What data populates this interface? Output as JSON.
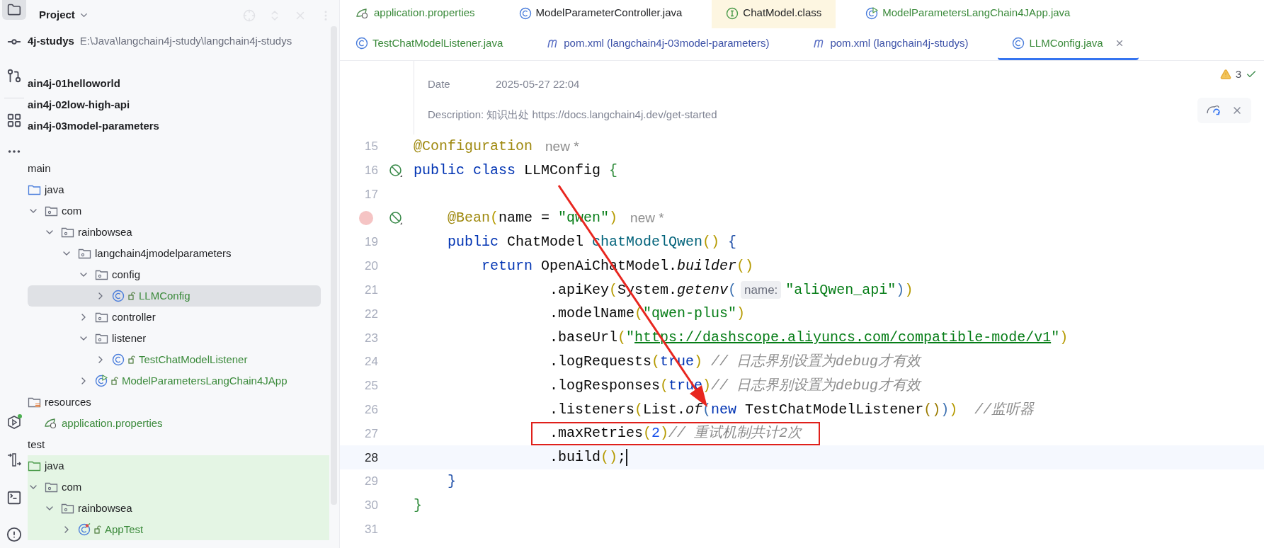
{
  "project_panel": {
    "title": "Project",
    "tree": [
      {
        "label": "4j-studys",
        "kind": "module_root",
        "path": "E:\\Java\\langchain4j-study\\langchain4j-studys",
        "selected": false
      },
      {
        "label": "ain4j-01helloworld",
        "kind": "module",
        "selected": false
      },
      {
        "label": "ain4j-02low-high-api",
        "kind": "module",
        "selected": false
      },
      {
        "label": "ain4j-03model-parameters",
        "kind": "module",
        "selected": false
      },
      {
        "label": "main",
        "kind": "source_set",
        "selected": false,
        "children": [
          {
            "label": "java",
            "kind": "source_root",
            "selected": false,
            "children": [
              {
                "label": "com",
                "kind": "package",
                "expanded": true,
                "selected": false,
                "children": [
                  {
                    "label": "rainbowsea",
                    "kind": "package",
                    "expanded": true,
                    "selected": false,
                    "children": [
                      {
                        "label": "langchain4jmodelparameters",
                        "kind": "package",
                        "expanded": true,
                        "selected": false,
                        "children": [
                          {
                            "label": "config",
                            "kind": "package",
                            "expanded": true,
                            "selected": false,
                            "children": [
                              {
                                "label": "LLMConfig",
                                "kind": "class",
                                "expanded": false,
                                "new_file": true,
                                "selected": true
                              }
                            ]
                          },
                          {
                            "label": "controller",
                            "kind": "package",
                            "expanded": false,
                            "selected": false
                          },
                          {
                            "label": "listener",
                            "kind": "package",
                            "expanded": true,
                            "selected": false,
                            "children": [
                              {
                                "label": "TestChatModelListener",
                                "kind": "class",
                                "expanded": false,
                                "new_file": true,
                                "selected": false
                              }
                            ]
                          },
                          {
                            "label": "ModelParametersLangChain4JApp",
                            "kind": "app",
                            "expanded": false,
                            "new_file": true,
                            "selected": false
                          }
                        ]
                      }
                    ]
                  }
                ]
              }
            ]
          },
          {
            "label": "resources",
            "kind": "resources",
            "selected": false,
            "children": [
              {
                "label": "application.properties",
                "kind": "properties",
                "new_file": true,
                "selected": false
              }
            ]
          }
        ]
      },
      {
        "label": "test",
        "kind": "source_set",
        "selected": false,
        "children": [
          {
            "label": "java",
            "kind": "test_root",
            "selected": false,
            "children": [
              {
                "label": "com",
                "kind": "package",
                "expanded": true,
                "selected": false,
                "children": [
                  {
                    "label": "rainbowsea",
                    "kind": "package",
                    "expanded": true,
                    "selected": false,
                    "children": [
                      {
                        "label": "AppTest",
                        "kind": "test_class",
                        "expanded": false,
                        "new_file": true,
                        "selected": false
                      }
                    ]
                  }
                ]
              }
            ]
          }
        ]
      }
    ]
  },
  "tabs": [
    [
      {
        "label": "application.properties",
        "kind": "properties",
        "new_file": true,
        "modified": false,
        "library": false,
        "selected": false
      },
      {
        "label": "ModelParameterController.java",
        "kind": "class",
        "new_file": false,
        "modified": false,
        "library": false,
        "selected": false
      },
      {
        "label": "ChatModel.class",
        "kind": "interface",
        "new_file": false,
        "modified": false,
        "library": true,
        "selected": false
      },
      {
        "label": "ModelParametersLangChain4JApp.java",
        "kind": "app",
        "new_file": true,
        "modified": false,
        "library": false,
        "selected": false
      }
    ],
    [
      {
        "label": "TestChatModelListener.java",
        "kind": "class",
        "new_file": true,
        "modified": false,
        "library": false,
        "selected": false
      },
      {
        "label": "pom.xml (langchain4j-03model-parameters)",
        "kind": "maven",
        "new_file": false,
        "modified": true,
        "library": false,
        "selected": false
      },
      {
        "label": "pom.xml (langchain4j-studys)",
        "kind": "maven",
        "new_file": false,
        "modified": true,
        "library": false,
        "selected": false
      },
      {
        "label": "LLMConfig.java",
        "kind": "class",
        "new_file": true,
        "modified": false,
        "library": false,
        "selected": true
      }
    ]
  ],
  "doc_header": {
    "date_label": "Date",
    "date": "2025-05-27 22:04",
    "description": "Description: 知识出处 https://docs.langchain4j.dev/get-started"
  },
  "inspections": {
    "warnings": "3"
  },
  "lines": [
    {
      "number": "15",
      "kind": "top",
      "author": "new *",
      "code": [
        {
          "kind": "annotation",
          "text": "@Configuration"
        }
      ]
    },
    {
      "number": "16",
      "kind": "top",
      "gutter_icon": true,
      "code": [
        {
          "kind": "keyword",
          "text": "public class "
        },
        {
          "kind": "plain",
          "text": "LLMConfig "
        },
        {
          "kind": "brace",
          "text": "{"
        }
      ]
    },
    {
      "number": "17",
      "kind": "top"
    },
    {
      "kind": "member",
      "gutter_icon": true,
      "breakpoint": true,
      "author": "new *",
      "code": [
        {
          "kind": "annotation",
          "text": "@Bean"
        },
        {
          "kind": "paren",
          "text": "("
        },
        {
          "kind": "plain",
          "text": "name = "
        },
        {
          "kind": "string",
          "text": "\"qwen\""
        },
        {
          "kind": "paren",
          "text": ")"
        }
      ]
    },
    {
      "number": "19",
      "kind": "member",
      "code": [
        {
          "kind": "keyword",
          "text": "public "
        },
        {
          "kind": "plain",
          "text": "ChatModel "
        },
        {
          "kind": "method",
          "text": "chatModelQwen"
        },
        {
          "kind": "paren",
          "text": "()"
        },
        {
          "kind": "brace2",
          "text": " {"
        }
      ]
    },
    {
      "number": "20",
      "kind": "body",
      "code": [
        {
          "kind": "keyword",
          "text": "return "
        },
        {
          "kind": "plain",
          "text": "OpenAiChatModel."
        },
        {
          "kind": "static",
          "text": "builder"
        },
        {
          "kind": "paren",
          "text": "()"
        }
      ]
    },
    {
      "number": "21",
      "kind": "chain",
      "code": [
        {
          "kind": "plain",
          "text": ".apiKey"
        },
        {
          "kind": "paren",
          "text": "("
        },
        {
          "kind": "plain",
          "text": "System."
        },
        {
          "kind": "static",
          "text": "getenv"
        },
        {
          "kind": "paren2",
          "text": "("
        },
        {
          "kind": "hint",
          "text": "name:"
        },
        {
          "kind": "string",
          "text": "\"aliQwen_api\""
        },
        {
          "kind": "paren2",
          "text": ")"
        },
        {
          "kind": "paren",
          "text": ")"
        }
      ]
    },
    {
      "number": "22",
      "kind": "chain",
      "code": [
        {
          "kind": "plain",
          "text": ".modelName"
        },
        {
          "kind": "paren",
          "text": "("
        },
        {
          "kind": "string",
          "text": "\"qwen-plus\""
        },
        {
          "kind": "paren",
          "text": ")"
        }
      ]
    },
    {
      "number": "23",
      "kind": "chain",
      "code": [
        {
          "kind": "plain",
          "text": ".baseUrl"
        },
        {
          "kind": "paren",
          "text": "("
        },
        {
          "kind": "string",
          "text": "\""
        },
        {
          "kind": "link",
          "text": "https://dashscope.aliyuncs.com/compatible-mode/v1"
        },
        {
          "kind": "string",
          "text": "\""
        },
        {
          "kind": "paren",
          "text": ")"
        }
      ]
    },
    {
      "number": "24",
      "kind": "chain",
      "code": [
        {
          "kind": "plain",
          "text": ".logRequests"
        },
        {
          "kind": "paren",
          "text": "("
        },
        {
          "kind": "keyword",
          "text": "true"
        },
        {
          "kind": "paren",
          "text": ")"
        },
        {
          "kind": "comment",
          "text": " // 日志界别设置为debug才有效"
        }
      ]
    },
    {
      "number": "25",
      "kind": "chain",
      "code": [
        {
          "kind": "plain",
          "text": ".logResponses"
        },
        {
          "kind": "paren",
          "text": "("
        },
        {
          "kind": "keyword",
          "text": "true"
        },
        {
          "kind": "paren",
          "text": ")"
        },
        {
          "kind": "comment",
          "text": "// 日志界别设置为debug才有效"
        }
      ]
    },
    {
      "number": "26",
      "kind": "chain",
      "code": [
        {
          "kind": "plain",
          "text": ".listeners"
        },
        {
          "kind": "paren",
          "text": "("
        },
        {
          "kind": "plain",
          "text": "List."
        },
        {
          "kind": "static",
          "text": "of"
        },
        {
          "kind": "paren2",
          "text": "("
        },
        {
          "kind": "keyword",
          "text": "new "
        },
        {
          "kind": "plain",
          "text": "TestChatModelListener"
        },
        {
          "kind": "paren3",
          "text": "()"
        },
        {
          "kind": "paren2",
          "text": ")"
        },
        {
          "kind": "paren",
          "text": ")"
        },
        {
          "kind": "comment",
          "text": "  //监听器"
        }
      ]
    },
    {
      "number": "27",
      "kind": "chain",
      "boxed": true,
      "code": [
        {
          "kind": "plain",
          "text": ".maxRetries"
        },
        {
          "kind": "paren",
          "text": "("
        },
        {
          "kind": "number",
          "text": "2"
        },
        {
          "kind": "paren",
          "text": ")"
        },
        {
          "kind": "comment",
          "text": "// 重试机制共计2次"
        }
      ]
    },
    {
      "number": "28",
      "kind": "chain",
      "current": true,
      "code": [
        {
          "kind": "plain",
          "text": ".build"
        },
        {
          "kind": "paren",
          "text": "()"
        },
        {
          "kind": "plain",
          "text": ";"
        }
      ]
    },
    {
      "number": "29",
      "kind": "member",
      "code": [
        {
          "kind": "brace2",
          "text": "}"
        }
      ]
    },
    {
      "number": "30",
      "kind": "top",
      "code": [
        {
          "kind": "brace",
          "text": "}"
        }
      ]
    },
    {
      "number": "31",
      "kind": "top"
    }
  ]
}
